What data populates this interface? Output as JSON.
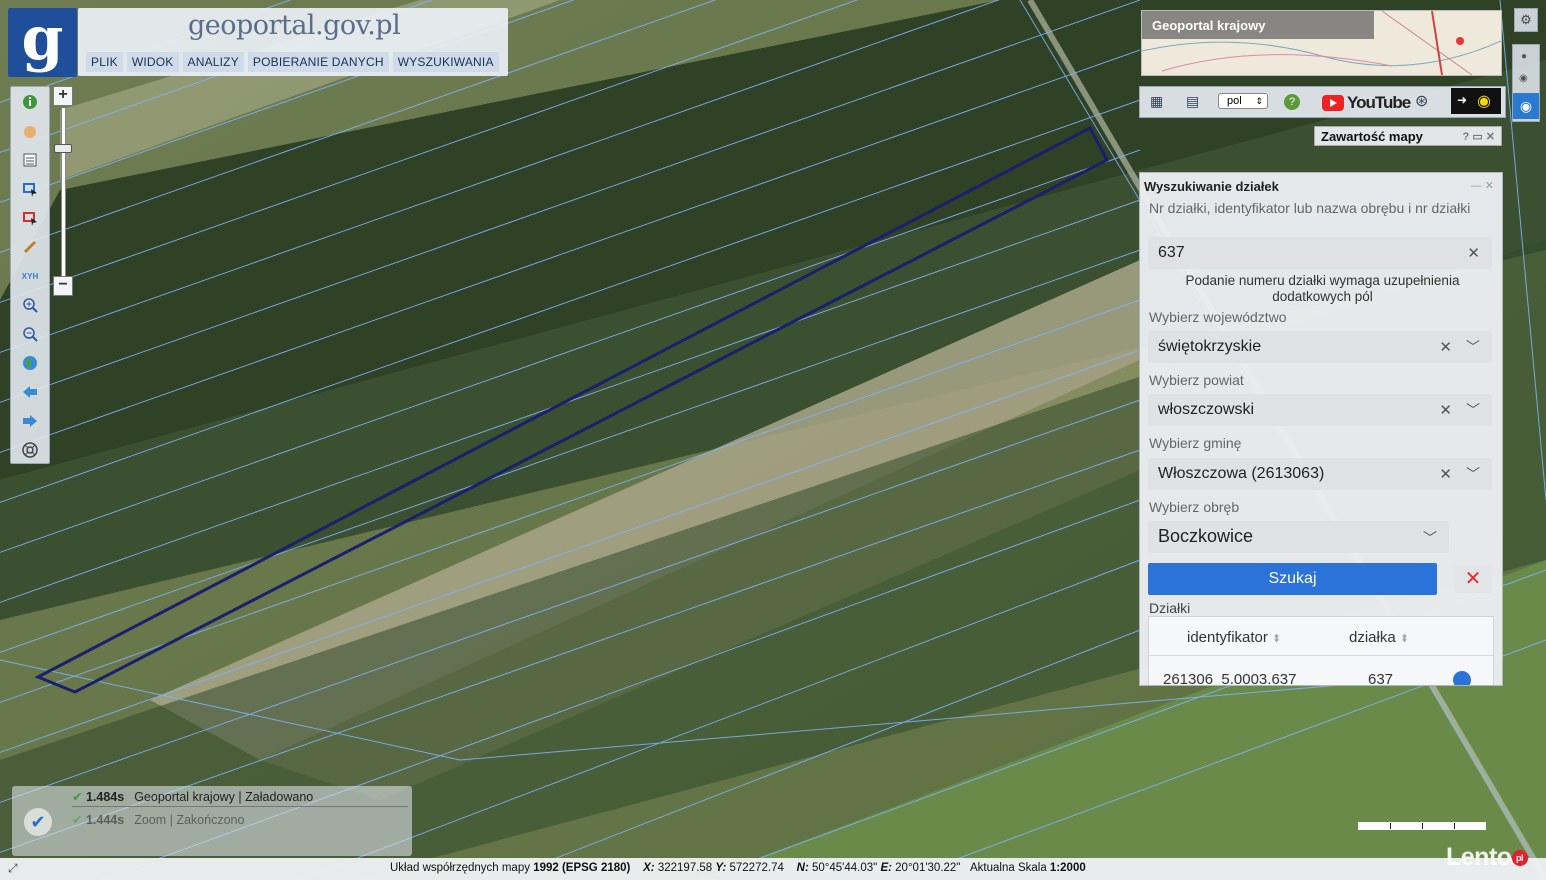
{
  "app": {
    "logo_letter": "g",
    "title": "geoportal.gov.pl"
  },
  "menu": {
    "items": [
      "PLIK",
      "WIDOK",
      "ANALIZY",
      "POBIERANIE DANYCH",
      "WYSZUKIWANIA"
    ]
  },
  "toolbar": {
    "icons": [
      "info-icon",
      "pan-hand-icon",
      "legend-icon",
      "select-area-icon",
      "clear-selection-icon",
      "draw-pencil-icon",
      "xyz-coordinates-icon",
      "zoom-in-icon",
      "zoom-out-icon",
      "globe-icon",
      "back-arrow-icon",
      "forward-arrow-icon",
      "help-wheel-icon"
    ],
    "xyz_label": "XYH",
    "zoom_in": "+",
    "zoom_out": "−"
  },
  "overview": {
    "label": "Geoportal krajowy"
  },
  "iconbar": {
    "language": "pol",
    "youtube_label": "YouTube",
    "help": "?"
  },
  "map_contents": {
    "label": "Zawartość mapy",
    "controls": "? ▭ ✕"
  },
  "search_panel": {
    "title": "Wyszukiwanie działek",
    "controls": "— ✕",
    "query_label": "Nr działki, identyfikator lub nazwa obrębu i nr działki",
    "query_value": "637",
    "hint": "Podanie numeru działki wymaga uzupełnienia dodatkowych pól",
    "voivodeship_label": "Wybierz województwo",
    "voivodeship_value": "świętokrzyskie",
    "county_label": "Wybierz powiat",
    "county_value": "włoszczowski",
    "commune_label": "Wybierz gminę",
    "commune_value": "Włoszczowa (2613063)",
    "precinct_label": "Wybierz obręb",
    "precinct_value": "Boczkowice",
    "search_button": "Szukaj",
    "cancel_button": "✕",
    "results_label": "Działki",
    "col_identifier": "identyfikator",
    "col_parcel": "działka",
    "row_identifier": "261306_5.0003.637",
    "row_parcel": "637"
  },
  "loading": {
    "rows": [
      {
        "time": "1.484s",
        "source": "Geoportal krajowy",
        "status": "Załadowano"
      },
      {
        "time": "1.444s",
        "source": "Zoom",
        "status": "Zakończono"
      }
    ]
  },
  "statusbar": {
    "crs_prefix": "Układ współrzędnych mapy",
    "crs_value": "1992 (EPSG 2180)",
    "x_label": "X:",
    "x_value": "322197.58",
    "y_label": "Y:",
    "y_value": "572272.74",
    "n_label": "N:",
    "n_value": "50°45'44.03\"",
    "e_label": "E:",
    "e_value": "20°01'30.22\"",
    "scale_label": "Aktualna Skala",
    "scale_value": "1:2000"
  },
  "watermark": {
    "text": "Lento",
    "badge": "pl"
  },
  "colors": {
    "accent": "#2b73d9",
    "parcel_outline": "#1a1f6e",
    "parcel_lines": "#7fb5ff",
    "cancel": "#e03030"
  }
}
